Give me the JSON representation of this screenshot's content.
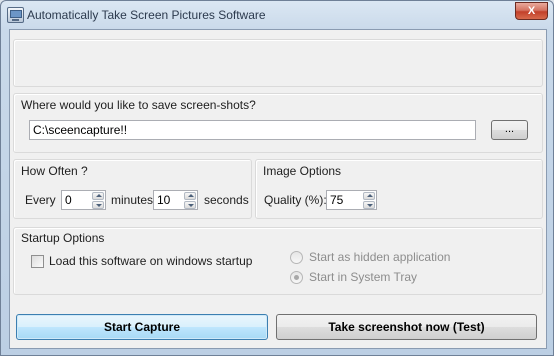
{
  "window": {
    "title": "Automatically Take Screen Pictures Software",
    "close_label": "X"
  },
  "save_location": {
    "heading": "Where would you like to save screen-shots?",
    "path_value": "C:\\sceencapture!!",
    "browse_label": "..."
  },
  "how_often": {
    "heading": "How Often ?",
    "every_label": "Every",
    "minutes_value": "0",
    "minutes_label": "minutes",
    "seconds_value": "10",
    "seconds_label": "seconds"
  },
  "image_options": {
    "heading": "Image Options",
    "quality_label": "Quality (%):",
    "quality_value": "75"
  },
  "startup_options": {
    "heading": "Startup Options",
    "load_on_startup_label": "Load this software on windows startup",
    "load_on_startup_checked": false,
    "radio_hidden_label": "Start as hidden application",
    "radio_tray_label": "Start in System Tray",
    "selected_mode": "Start in System Tray"
  },
  "actions": {
    "start_label": "Start Capture",
    "test_label": "Take screenshot now (Test)"
  }
}
